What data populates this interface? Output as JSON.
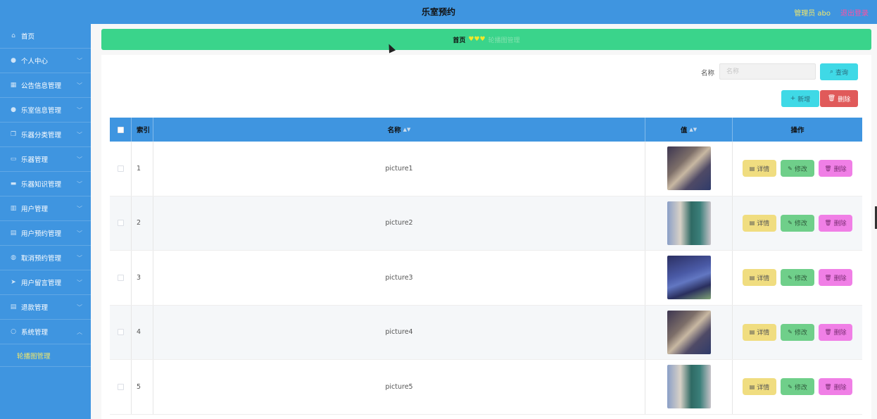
{
  "header": {
    "title": "乐室预约",
    "admin": "管理员 abo",
    "logout": "退出登录"
  },
  "sidebar": {
    "items": [
      {
        "label": "首页",
        "icon": "home-icon",
        "glyph": "⌂",
        "chevron": false
      },
      {
        "label": "个人中心",
        "icon": "user-icon",
        "glyph": "●",
        "chevron": true
      },
      {
        "label": "公告信息管理",
        "icon": "grid-icon",
        "glyph": "▦",
        "chevron": true
      },
      {
        "label": "乐室信息管理",
        "icon": "user-icon",
        "glyph": "●",
        "chevron": true
      },
      {
        "label": "乐器分类管理",
        "icon": "copy-icon",
        "glyph": "❐",
        "chevron": true
      },
      {
        "label": "乐器管理",
        "icon": "chat-icon",
        "glyph": "▭",
        "chevron": true
      },
      {
        "label": "乐器知识管理",
        "icon": "camera-icon",
        "glyph": "▬",
        "chevron": true
      },
      {
        "label": "用户管理",
        "icon": "building-icon",
        "glyph": "▥",
        "chevron": true
      },
      {
        "label": "用户预约管理",
        "icon": "calendar-icon",
        "glyph": "▤",
        "chevron": true
      },
      {
        "label": "取消预约管理",
        "icon": "location-icon",
        "glyph": "◍",
        "chevron": true
      },
      {
        "label": "用户留言管理",
        "icon": "send-icon",
        "glyph": "➤",
        "chevron": true
      },
      {
        "label": "退款管理",
        "icon": "list-icon",
        "glyph": "▤",
        "chevron": true
      },
      {
        "label": "系统管理",
        "icon": "setting-icon",
        "glyph": "○",
        "chevron": true,
        "open": true
      }
    ],
    "submenu": {
      "label": "轮播图管理"
    }
  },
  "breadcrumb": {
    "home": "首页",
    "separator": "♥♥♥",
    "current": "轮播图管理"
  },
  "search": {
    "label": "名称",
    "placeholder": "名称",
    "button": "查询",
    "button_icon": "search-icon"
  },
  "actions": {
    "add": "新增",
    "add_icon": "plus-icon",
    "delete": "删除",
    "delete_icon": "trash-icon"
  },
  "table": {
    "headers": {
      "index": "索引",
      "name": "名称",
      "value": "值",
      "ops": "操作"
    },
    "rows": [
      {
        "index": "1",
        "name": "picture1",
        "thumb": "linear-gradient(135deg,#3c3550 0%,#7d6f69 35%,#c8b8a2 50%,#4f4a66 70%,#2f3b6a 100%)"
      },
      {
        "index": "2",
        "name": "picture2",
        "thumb": "linear-gradient(90deg,#8a9fc7 0%,#d8d1c7 30%,#2f6a64 55%,#3b7f7a 75%,#c6c2c8 100%)"
      },
      {
        "index": "3",
        "name": "picture3",
        "thumb": "linear-gradient(160deg,#2b2f62 0%,#4a5aa6 40%,#6277c2 55%,#2a2f5e 75%,#7fa374 100%)"
      },
      {
        "index": "4",
        "name": "picture4",
        "thumb": "linear-gradient(135deg,#3c3550 0%,#7d6f69 35%,#c8b8a2 50%,#4f4a66 70%,#2f3b6a 100%)"
      },
      {
        "index": "5",
        "name": "picture5",
        "thumb": "linear-gradient(90deg,#8a9fc7 0%,#d8d1c7 30%,#2f6a64 55%,#3b7f7a 75%,#c6c2c8 100%)"
      }
    ],
    "row_actions": {
      "detail": "详情",
      "edit": "修改",
      "delete": "删除"
    }
  },
  "colors": {
    "header": "#3f95e0",
    "breadcrumb": "#3ad48b",
    "accent_cyan": "#3fd9e6",
    "danger": "#e05a5a",
    "detail": "#f0dd80",
    "edit": "#6fcf8a",
    "pink": "#f07fe6"
  }
}
